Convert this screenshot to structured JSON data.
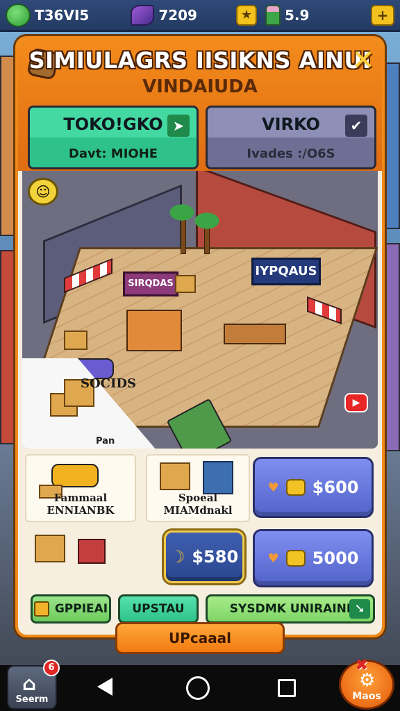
{
  "topbar": {
    "player_name": "T36VI5",
    "gems": "7209",
    "coins_icon": "★",
    "plants": "5.9",
    "plus": "+"
  },
  "panel": {
    "title": "SIMIULAGRS IISIKNS AINUI",
    "subtitle": "VINDAIUDA",
    "close": "✕",
    "modes": [
      {
        "name": "TOKO!GKO",
        "sub": "Davt: MIOHE",
        "icon": "send-icon"
      },
      {
        "name": "VIRKO",
        "sub": "Ivades :/O6S",
        "icon": "check-icon"
      }
    ]
  },
  "scene": {
    "shop_sign": "IYPQAUS",
    "shop_sign2": "SIRQDAS",
    "sales_label": "SOCIDS",
    "cart_label": "Pan",
    "badge": "▶"
  },
  "shop": {
    "items": [
      {
        "label": "Fammaal ENNIANBK"
      },
      {
        "label": "Spoeal MIAMdnakl"
      },
      {
        "label": ""
      }
    ],
    "prices": [
      {
        "value": "$600",
        "icon": "heart-icon"
      },
      {
        "value": "$580",
        "icon": "moon-icon"
      },
      {
        "value": "5000",
        "icon": "heart-icon"
      }
    ]
  },
  "tabs": [
    {
      "label": "GPPIEAI"
    },
    {
      "label": "UPSTAU"
    },
    {
      "label": "SYSDMK UNIRAINI"
    }
  ],
  "upgrade_label": "UPcaaal",
  "bottom": {
    "home_label": "Seerm",
    "notif_count": "6",
    "more_label": "Maos"
  },
  "colors": {
    "panel_border": "#f08a1a",
    "green_card": "#2ec28a",
    "gray_card": "#6e6f94",
    "price_button": "#5263c9"
  }
}
